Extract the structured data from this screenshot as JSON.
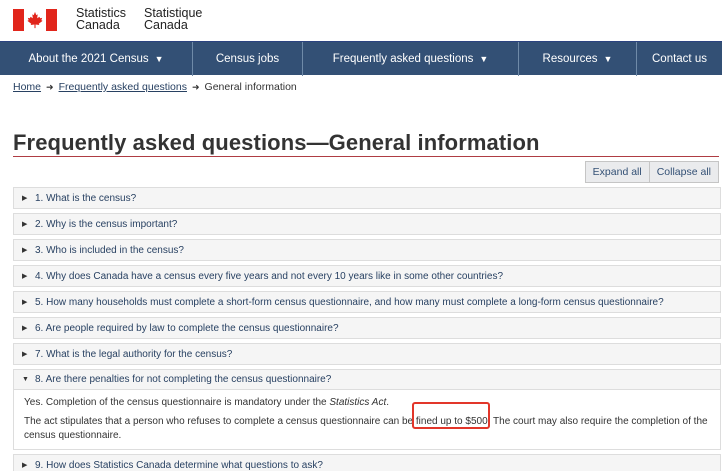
{
  "header": {
    "wordmark_en_line1": "Statistics",
    "wordmark_en_line2": "Canada",
    "wordmark_fr_line1": "Statistique",
    "wordmark_fr_line2": "Canada",
    "flag_icon": "canada-flag-icon"
  },
  "nav": {
    "items": [
      {
        "label": "About the 2021 Census",
        "dropdown": true
      },
      {
        "label": "Census jobs",
        "dropdown": false
      },
      {
        "label": "Frequently asked questions",
        "dropdown": true
      },
      {
        "label": "Resources",
        "dropdown": true
      },
      {
        "label": "Contact us",
        "dropdown": false
      }
    ]
  },
  "breadcrumb": {
    "home": "Home",
    "faq": "Frequently asked questions",
    "current": "General information"
  },
  "page": {
    "title": "Frequently asked questions—General information"
  },
  "controls": {
    "expand_all": "Expand all",
    "collapse_all": "Collapse all"
  },
  "faq": {
    "q1": "1. What is the census?",
    "q2": "2. Why is the census important?",
    "q3": "3. Who is included in the census?",
    "q4": "4. Why does Canada have a census every five years and not every 10 years like in some other countries?",
    "q5": "5. How many households must complete a short-form census questionnaire, and how many must complete a long-form census questionnaire?",
    "q6": "6. Are people required by law to complete the census questionnaire?",
    "q7": "7. What is the legal authority for the census?",
    "q8": "8. Are there penalties for not completing the census questionnaire?",
    "q8_answer_p1_a": "Yes. Completion of the census questionnaire is mandatory under the ",
    "q8_answer_p1_act": "Statistics Act",
    "q8_answer_p1_b": ".",
    "q8_answer_p2_a": "The act stipulates that a person who refuses to complete a census questionnaire can be ",
    "q8_answer_p2_hl": "fined up to $500.",
    "q8_answer_p2_b": " The court may also require the completion of the census questionnaire.",
    "q9": "9. How does Statistics Canada determine what questions to ask?"
  },
  "colors": {
    "nav_bg": "#335075",
    "link": "#284162",
    "title_rule": "#af3c43",
    "highlight": "#e2362a",
    "flag_red": "#e1251b"
  }
}
